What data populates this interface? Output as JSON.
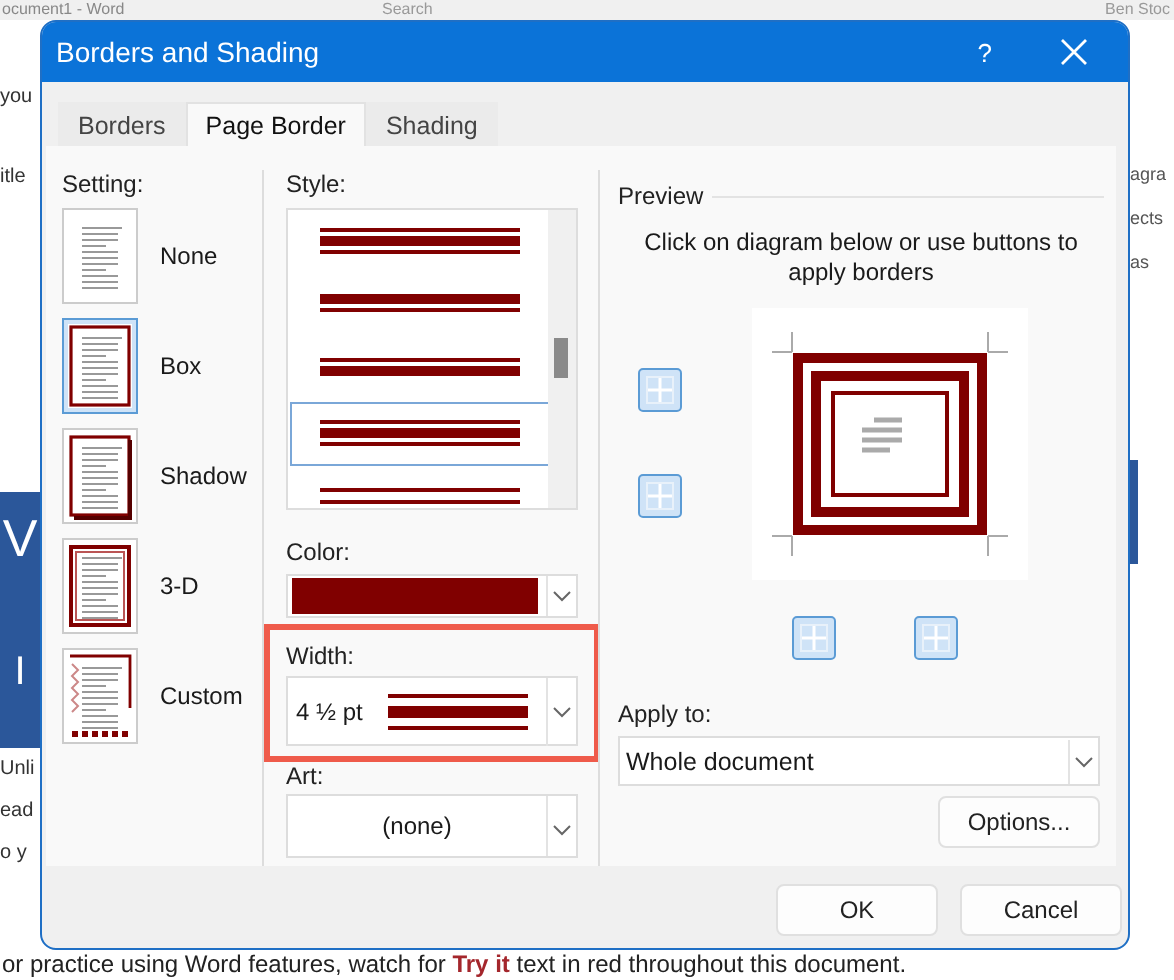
{
  "background": {
    "app_title": "ocument1  -  Word",
    "search": "Search",
    "user": "Ben Stoc",
    "left_texts": [
      "you",
      "itle"
    ],
    "banner_texts": [
      "V",
      "I"
    ],
    "lower_left_texts": [
      "Unli",
      "ead",
      "o y"
    ],
    "right_texts": [
      "agra",
      "ects",
      "as"
    ],
    "footer_line": "or practice using Word features, watch for **Try it** text in red throughout this document."
  },
  "dialog": {
    "title": "Borders and Shading",
    "help": "?",
    "tabs": [
      {
        "label": "Borders",
        "selected": false
      },
      {
        "label": "Page Border",
        "selected": true
      },
      {
        "label": "Shading",
        "selected": false
      }
    ],
    "setting": {
      "label": "Setting:",
      "options": [
        {
          "label": "None",
          "kind": "none",
          "selected": false
        },
        {
          "label": "Box",
          "kind": "box",
          "selected": true
        },
        {
          "label": "Shadow",
          "kind": "shadow",
          "selected": false
        },
        {
          "label": "3-D",
          "kind": "raised",
          "selected": false
        },
        {
          "label": "Custom",
          "kind": "custom",
          "selected": false
        }
      ]
    },
    "style": {
      "label": "Style:",
      "items": [
        {
          "kind": "thin-thick-thin",
          "selected": false
        },
        {
          "kind": "thick-thin",
          "selected": false
        },
        {
          "kind": "thin-thick",
          "selected": false
        },
        {
          "kind": "thin-thick-thin",
          "selected": true
        },
        {
          "kind": "thin-thin",
          "selected": false
        }
      ]
    },
    "color": {
      "label": "Color:"
    },
    "width": {
      "label": "Width:",
      "value": "4 ½ pt",
      "highlighted": true
    },
    "art": {
      "label": "Art:",
      "value": "(none)"
    },
    "preview": {
      "label": "Preview",
      "hint": "Click on diagram below or use buttons to apply borders",
      "border_buttons": [
        {
          "on": true
        },
        {
          "on": true
        },
        {
          "on": true
        },
        {
          "on": true
        }
      ]
    },
    "apply_to": {
      "label": "Apply to:",
      "value": "Whole document"
    },
    "buttons": {
      "options": "Options...",
      "ok": "OK",
      "cancel": "Cancel"
    }
  }
}
